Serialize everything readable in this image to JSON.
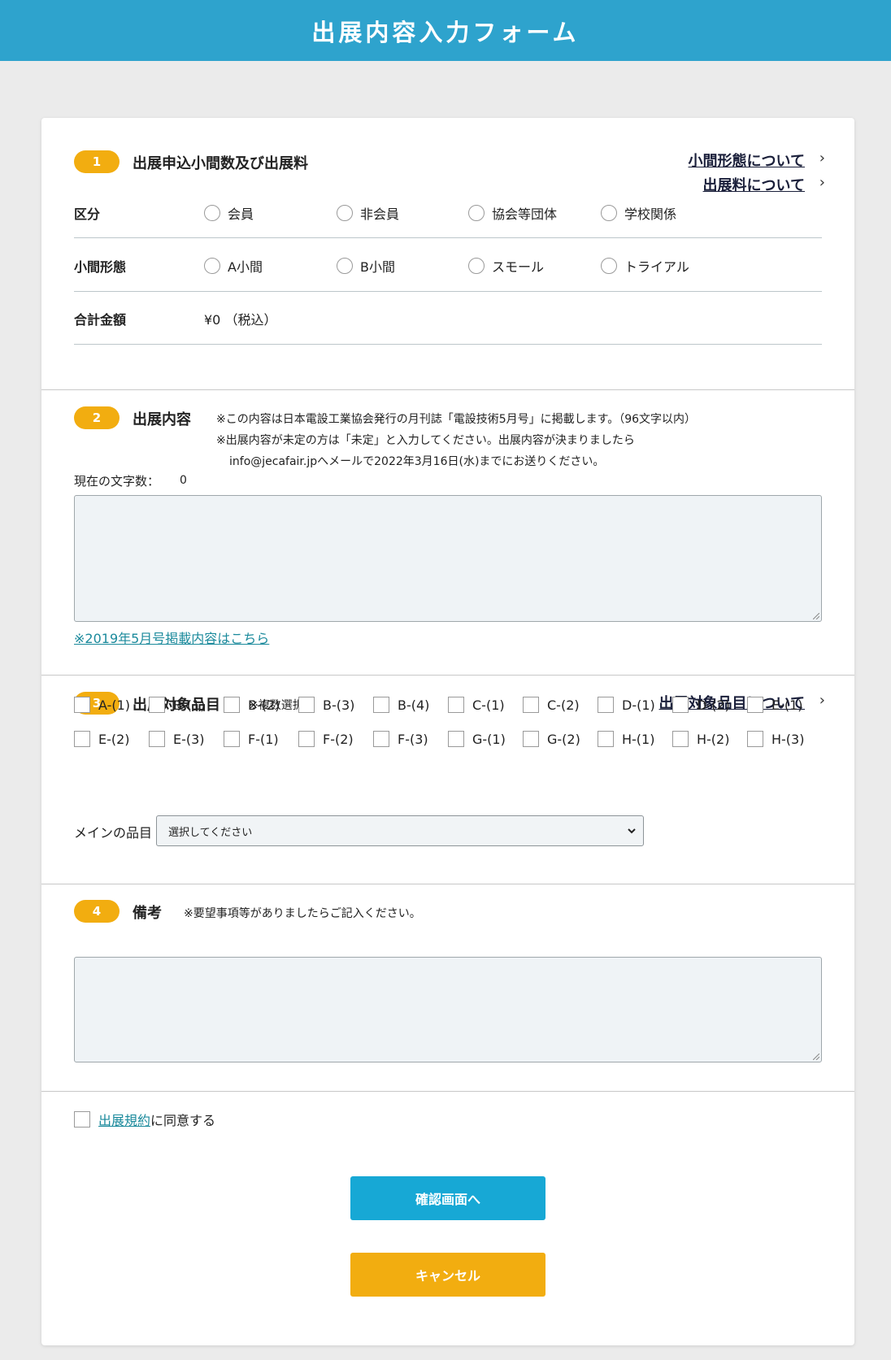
{
  "header": {
    "title": "出展内容入力フォーム"
  },
  "section1": {
    "number": "1",
    "title": "出展申込小間数及び出展料",
    "link_booth": "小間形態について",
    "link_fee": "出展料について",
    "category_label": "区分",
    "category_options": [
      "会員",
      "非会員",
      "協会等団体",
      "学校関係"
    ],
    "booth_label": "小間形態",
    "booth_options": [
      "A小間",
      "B小間",
      "スモール",
      "トライアル"
    ],
    "total_label": "合計金額",
    "total_value": "¥0 （税込）"
  },
  "section2": {
    "number": "2",
    "title": "出展内容",
    "note1": "※この内容は日本電設工業協会発行の月刊誌「電設技術5月号」に掲載します。（96文字以内）",
    "note2": "※出展内容が未定の方は「未定」と入力してください。出展内容が決まりましたら",
    "note3": "info@jecafair.jpへメールで2022年3月16日(水)までにお送りください。",
    "char_count_label": "現在の文字数：",
    "char_count": "0",
    "link_past": "※2019年5月号掲載内容はこちら"
  },
  "section3": {
    "number": "3",
    "title": "出展対象品目",
    "note": "※複数選択可",
    "link": "出展対象品目について",
    "items_row1": [
      "A-(1)",
      "B-(1)",
      "B-(2)",
      "B-(3)",
      "B-(4)",
      "C-(1)",
      "C-(2)",
      "D-(1)",
      "D-(2)",
      "E-(1)"
    ],
    "items_row2": [
      "E-(2)",
      "E-(3)",
      "F-(1)",
      "F-(2)",
      "F-(3)",
      "G-(1)",
      "G-(2)",
      "H-(1)",
      "H-(2)",
      "H-(3)"
    ],
    "main_label": "メインの品目",
    "main_select": "選択してください"
  },
  "section4": {
    "number": "4",
    "title": "備考",
    "note": "※要望事項等がありましたらご記入ください。"
  },
  "agree": {
    "link": "出展規約",
    "text": "に同意する"
  },
  "buttons": {
    "confirm": "確認画面へ",
    "cancel": "キャンセル"
  },
  "colors": {
    "header": "#2ea3cd",
    "badge": "#f2ad10",
    "confirm": "#17a8d5",
    "cancel": "#f2ad10",
    "link": "#1b8a9c"
  }
}
